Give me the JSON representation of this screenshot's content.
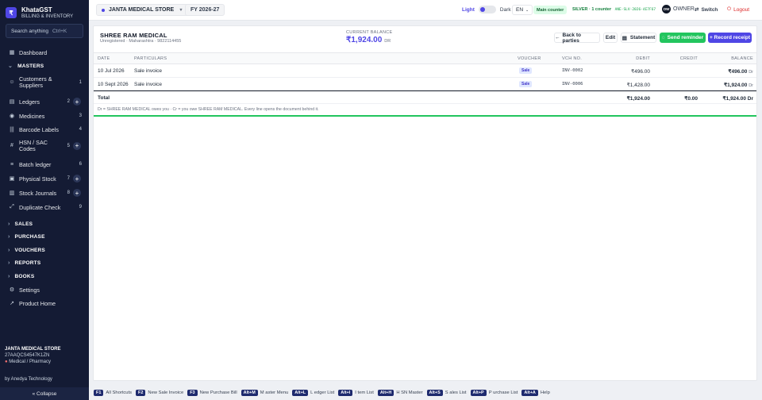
{
  "brand": {
    "logo": "₹",
    "name": "KhataGST",
    "subtitle": "BILLING & INVENTORY"
  },
  "search": {
    "placeholder": "Search anything",
    "shortcut": "Ctrl+K"
  },
  "sidebar": {
    "dashboard": "Dashboard",
    "masters_label": "MASTERS",
    "items": [
      {
        "label": "Customers & Suppliers",
        "count": "1"
      },
      {
        "label": "Ledgers",
        "count": "2"
      },
      {
        "label": "Medicines",
        "count": "3"
      },
      {
        "label": "Barcode Labels",
        "count": "4"
      },
      {
        "label": "HSN / SAC Codes",
        "count": "5"
      },
      {
        "label": "Batch ledger",
        "count": "6"
      },
      {
        "label": "Physical Stock",
        "count": "7"
      },
      {
        "label": "Stock Journals",
        "count": "8"
      },
      {
        "label": "Duplicate Check",
        "count": "9"
      }
    ],
    "sections": [
      "SALES",
      "PURCHASE",
      "VOUCHERS",
      "REPORTS",
      "BOOKS"
    ],
    "settings": "Settings",
    "product_home": "Product Home",
    "store_name": "JANTA MEDICAL STORE",
    "gstin": "27AAQCS4547K1ZN",
    "category": "Medical / Pharmacy",
    "by": "by Anedya Technology",
    "collapse": "« Collapse"
  },
  "topbar": {
    "store": "JANTA MEDICAL STORE",
    "fy": "FY 2026-27",
    "theme_light": "Light",
    "theme_dark": "Dark",
    "lang": "EN",
    "counter": "Main counter",
    "plan": "SILVER · 1 counter",
    "plan_code": "ANE-SLV-2026-4E7F67",
    "owner_initials": "OW",
    "owner": "OWNER",
    "switch": "Switch",
    "logout": "Logout"
  },
  "party": {
    "name": "SHREE RAM MEDICAL",
    "subtitle": "Unregistered · Maharashtra · 9822114455",
    "balance_label": "CURRENT BALANCE",
    "balance": "₹1,924.00",
    "balance_type": "DR"
  },
  "actions": {
    "back": "Back to parties",
    "edit": "Edit",
    "statement": "Statement",
    "reminder": "Send reminder",
    "receipt": "+ Record receipt"
  },
  "table": {
    "headers": [
      "DATE",
      "PARTICULARS",
      "VOUCHER",
      "VCH NO.",
      "DEBIT",
      "CREDIT",
      "BALANCE"
    ],
    "rows": [
      {
        "date": "10 Jul 2026",
        "particulars": "Sale invoice",
        "voucher": "Sale",
        "vch_no": "INV-0002",
        "debit": "₹496.00",
        "credit": "",
        "balance": "₹496.00",
        "bal_type": "Dr"
      },
      {
        "date": "10 Sept 2026",
        "particulars": "Sale invoice",
        "voucher": "Sale",
        "vch_no": "INV-0006",
        "debit": "₹1,428.00",
        "credit": "",
        "balance": "₹1,924.00",
        "bal_type": "Dr"
      }
    ],
    "total_label": "Total",
    "total_debit": "₹1,924.00",
    "total_credit": "₹0.00",
    "total_balance": "₹1,924.00",
    "total_bal_type": "Dr",
    "note": "Dr = SHREE RAM MEDICAL owes you  ·  Cr = you owe SHREE RAM MEDICAL. Every line opens the document behind it."
  },
  "shortcuts": [
    {
      "key": "F1",
      "label": "All Shortcuts"
    },
    {
      "key": "F2",
      "label": "New Sale Invoice"
    },
    {
      "key": "F3",
      "label": "New Purchase Bill"
    },
    {
      "key": "Alt+M",
      "label": "M aster Menu"
    },
    {
      "key": "Alt+L",
      "label": "L edger List"
    },
    {
      "key": "Alt+I",
      "label": "I tem List"
    },
    {
      "key": "Alt+H",
      "label": "H SN Master"
    },
    {
      "key": "Alt+S",
      "label": "S ales List"
    },
    {
      "key": "Alt+P",
      "label": "P urchase List"
    },
    {
      "key": "Alt+A",
      "label": "Help"
    }
  ],
  "colors": {
    "sidebar_bg": "#141b34",
    "accent": "#4f46e5",
    "success": "#22c55e",
    "danger": "#dc2626"
  }
}
